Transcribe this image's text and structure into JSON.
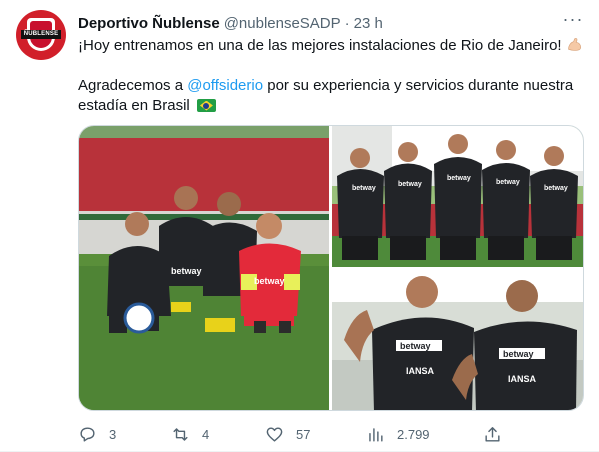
{
  "tweet": {
    "author_name": "Deportivo Ñublense",
    "handle": "@nublenseSADP",
    "separator": "·",
    "time": "23 h",
    "more_label": "···",
    "avatar_text": "ÑUBLENSE",
    "line1": "¡Hoy entrenamos en una de las mejores instalaciones de Rio de Janeiro!",
    "line2_prefix": "Agradecemos a ",
    "mention": "@offsiderio",
    "line2_suffix": " por su experiencia y servicios durante nuestra estadía en Brasil",
    "emoji1": "flexed-biceps",
    "emoji2": "brazil-flag"
  },
  "media": {
    "sponsor": "betway",
    "sponsor2": "IANSA",
    "colors": {
      "team_red": "#d11f2a",
      "jersey_black": "#222428",
      "grass": "#5a8f3a",
      "wall_red": "#b8323a"
    }
  },
  "actions": {
    "replies": "3",
    "retweets": "4",
    "likes": "57",
    "views": "2.799"
  },
  "colors": {
    "link": "#1d9bf0",
    "muted": "#536471",
    "text": "#0f1419"
  }
}
